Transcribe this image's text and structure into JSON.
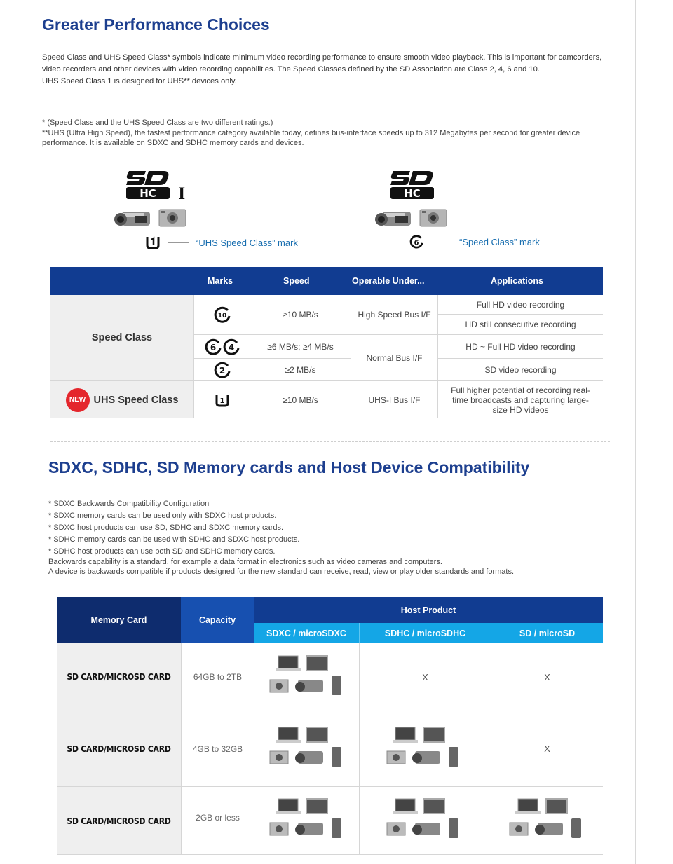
{
  "section1": {
    "title": "Greater Performance Choices",
    "intro": [
      "Speed Class and UHS Speed Class* symbols indicate minimum video recording performance to ensure smooth video playback. This is important for camcorders, video recorders and other devices with video recording capabilities. The Speed Classes defined by the SD Association are Class 2, 4, 6 and 10.",
      "UHS Speed Class 1 is designed for UHS** devices only."
    ],
    "notes": [
      "* (Speed Class and the UHS Speed Class are two different ratings.)",
      "**UHS (Ultra High Speed), the fastest performance category available today, defines bus-interface speeds up to 312 Megabytes per second for greater device performance. It is available on SDXC and SDHC memory cards and devices."
    ],
    "logos": {
      "left_numeral": "I",
      "left_caption": "“UHS Speed Class” mark",
      "right_caption": "“Speed Class” mark"
    }
  },
  "speed_table": {
    "headers": [
      "Marks",
      "Speed",
      "Operable Under...",
      "Applications"
    ],
    "row_speed_class": "Speed Class",
    "row_uhs": "UHS Speed Class",
    "new_badge": "NEW",
    "speeds": [
      "≥10 MB/s",
      "≥6 MB/s; ≥4 MB/s",
      "≥2 MB/s",
      "≥10 MB/s"
    ],
    "operable": [
      "High Speed Bus I/F",
      "Normal Bus I/F",
      "UHS-I Bus I/F"
    ],
    "applications": [
      "Full HD video recording",
      "HD still consecutive recording",
      "HD ~ Full HD video recording",
      "SD video recording",
      "Full higher potential of recording real-time broadcasts and capturing large-size HD videos"
    ],
    "mark_labels": [
      "10",
      "6",
      "4",
      "2",
      "1"
    ]
  },
  "section2": {
    "title": "SDXC, SDHC, SD Memory cards and Host Device Compatibility",
    "bullets": [
      "* SDXC Backwards Compatibility Configuration",
      "* SDXC memory cards can be used only with SDXC host products.",
      "* SDXC host products can use SD, SDHC and SDXC memory cards.",
      "* SDHC memory cards can be used with SDHC and SDXC host products.",
      "* SDHC host products can use both SD and SDHC memory cards."
    ],
    "explain": [
      "Backwards capability is a standard, for example a data format in electronics such as video cameras and computers.",
      "A device is backwards compatible if products designed for the new standard can receive, read, view or play older standards and formats."
    ]
  },
  "compat_table": {
    "memory_card": "Memory Card",
    "capacity": "Capacity",
    "host_product": "Host Product",
    "hosts": [
      "SDXC / microSDXC",
      "SDHC / microSDHC",
      "SD / microSD"
    ],
    "rows": [
      {
        "card": "SD CARD/MICROSD CARD",
        "capacity": "64GB to 2TB",
        "sdhc": "X",
        "sd": "X"
      },
      {
        "card": "SD CARD/MICROSD CARD",
        "capacity": "4GB to 32GB",
        "sd": "X"
      },
      {
        "card": "SD CARD/MICROSD CARD",
        "capacity": "2GB or less"
      }
    ]
  },
  "colors": {
    "title_blue": "#1d3f8f",
    "header_navy": "#113c91",
    "header_dark": "#0e2c6e",
    "header_cyan": "#14a6e6",
    "badge_red": "#e4262c",
    "caption_blue": "#1a6fb0"
  }
}
